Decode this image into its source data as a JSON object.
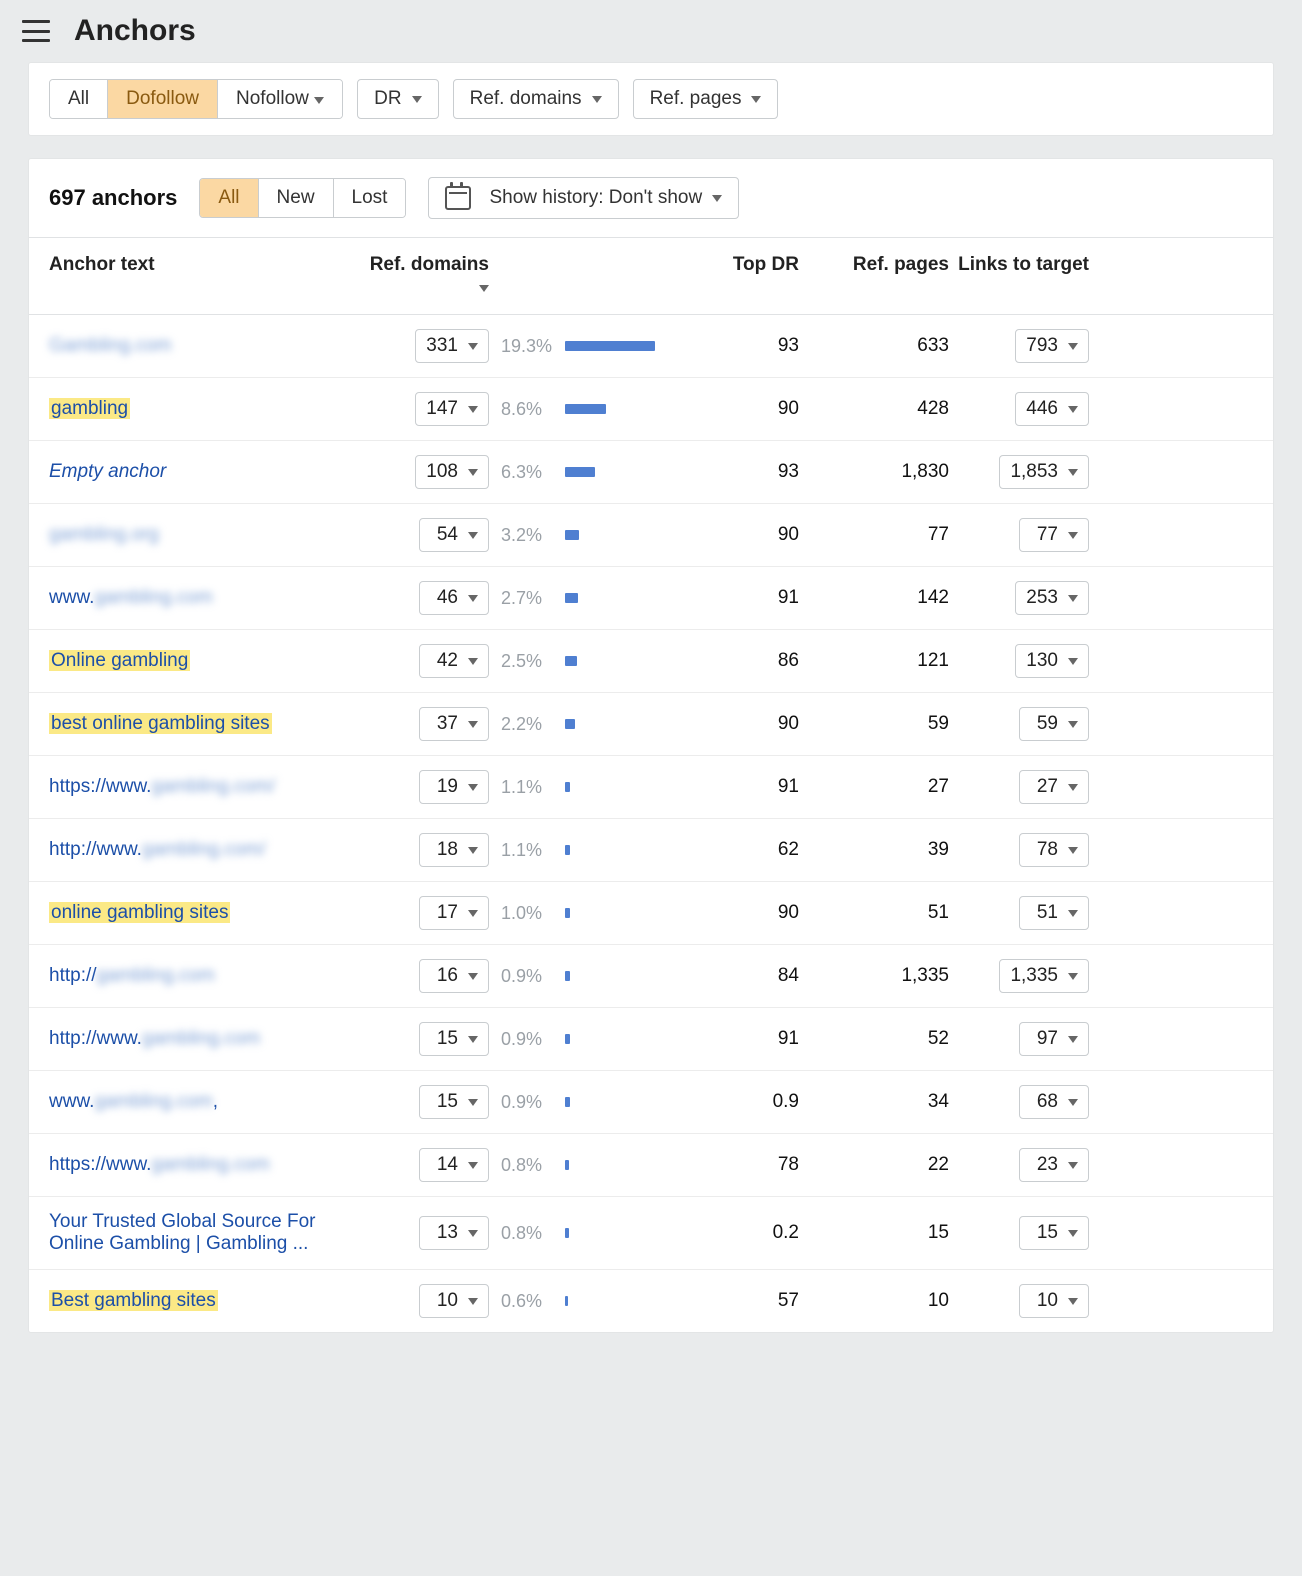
{
  "header": {
    "title": "Anchors"
  },
  "filters": {
    "follow": {
      "all": "All",
      "dofollow": "Dofollow",
      "nofollow": "Nofollow",
      "active": "dofollow"
    },
    "drop1": "DR",
    "drop2": "Ref. domains",
    "drop3": "Ref. pages"
  },
  "listbar": {
    "count": "697 anchors",
    "seg": {
      "all": "All",
      "new": "New",
      "lost": "Lost",
      "active": "all"
    },
    "history_label": "Show history: Don't show"
  },
  "columns": {
    "anchor": "Anchor text",
    "refd": "Ref. domains",
    "topdr": "Top DR",
    "refp": "Ref. pages",
    "links": "Links to target"
  },
  "rows": [
    {
      "text": "Gambling.com",
      "blur": true,
      "hl": false,
      "refd": "331",
      "pct": "19.3%",
      "barPct": 100,
      "topdr": "93",
      "refp": "633",
      "links": "793"
    },
    {
      "text": "gambling",
      "blur": false,
      "hl": true,
      "refd": "147",
      "pct": "8.6%",
      "barPct": 45,
      "topdr": "90",
      "refp": "428",
      "links": "446"
    },
    {
      "text": "Empty anchor",
      "blur": false,
      "hl": false,
      "italic": true,
      "refd": "108",
      "pct": "6.3%",
      "barPct": 33,
      "topdr": "93",
      "refp": "1,830",
      "links": "1,853"
    },
    {
      "text": "gambling.org",
      "blur": true,
      "hl": false,
      "refd": "54",
      "pct": "3.2%",
      "barPct": 16,
      "topdr": "90",
      "refp": "77",
      "links": "77"
    },
    {
      "prefix": "www.",
      "text": "gambling.com",
      "blur": true,
      "hl": false,
      "refd": "46",
      "pct": "2.7%",
      "barPct": 14,
      "topdr": "91",
      "refp": "142",
      "links": "253"
    },
    {
      "text": "Online gambling",
      "blur": false,
      "hl": true,
      "refd": "42",
      "pct": "2.5%",
      "barPct": 13,
      "topdr": "86",
      "refp": "121",
      "links": "130"
    },
    {
      "text": "best online gambling sites",
      "blur": false,
      "hl": true,
      "refd": "37",
      "pct": "2.2%",
      "barPct": 11,
      "topdr": "90",
      "refp": "59",
      "links": "59"
    },
    {
      "prefix": "https://www.",
      "text": "gambling.com/",
      "blur": true,
      "hl": false,
      "refd": "19",
      "pct": "1.1%",
      "barPct": 6,
      "topdr": "91",
      "refp": "27",
      "links": "27"
    },
    {
      "prefix": "http://www.",
      "text": "gambling.com/",
      "blur": true,
      "hl": false,
      "refd": "18",
      "pct": "1.1%",
      "barPct": 5,
      "topdr": "62",
      "refp": "39",
      "links": "78"
    },
    {
      "text": "online gambling sites",
      "blur": false,
      "hl": true,
      "refd": "17",
      "pct": "1.0%",
      "barPct": 5,
      "topdr": "90",
      "refp": "51",
      "links": "51"
    },
    {
      "prefix": "http://",
      "text": "gambling.com",
      "blur": true,
      "hl": false,
      "refd": "16",
      "pct": "0.9%",
      "barPct": 5,
      "topdr": "84",
      "refp": "1,335",
      "links": "1,335"
    },
    {
      "prefix": "http://www.",
      "text": "gambling.com",
      "blur": true,
      "hl": false,
      "refd": "15",
      "pct": "0.9%",
      "barPct": 5,
      "topdr": "91",
      "refp": "52",
      "links": "97"
    },
    {
      "prefix": "www.",
      "text": "gambling.com",
      "suffix": ",",
      "blur": true,
      "hl": false,
      "refd": "15",
      "pct": "0.9%",
      "barPct": 5,
      "topdr": "0.9",
      "refp": "34",
      "links": "68"
    },
    {
      "prefix": "https://www.",
      "text": "gambling.com",
      "blur": true,
      "hl": false,
      "refd": "14",
      "pct": "0.8%",
      "barPct": 4,
      "topdr": "78",
      "refp": "22",
      "links": "23"
    },
    {
      "text": "Your Trusted Global Source For Online Gambling | Gambling ...",
      "blur": false,
      "hl": false,
      "refd": "13",
      "pct": "0.8%",
      "barPct": 4,
      "topdr": "0.2",
      "refp": "15",
      "links": "15"
    },
    {
      "text": "Best gambling sites",
      "blur": false,
      "hl": true,
      "refd": "10",
      "pct": "0.6%",
      "barPct": 3,
      "topdr": "57",
      "refp": "10",
      "links": "10"
    }
  ]
}
